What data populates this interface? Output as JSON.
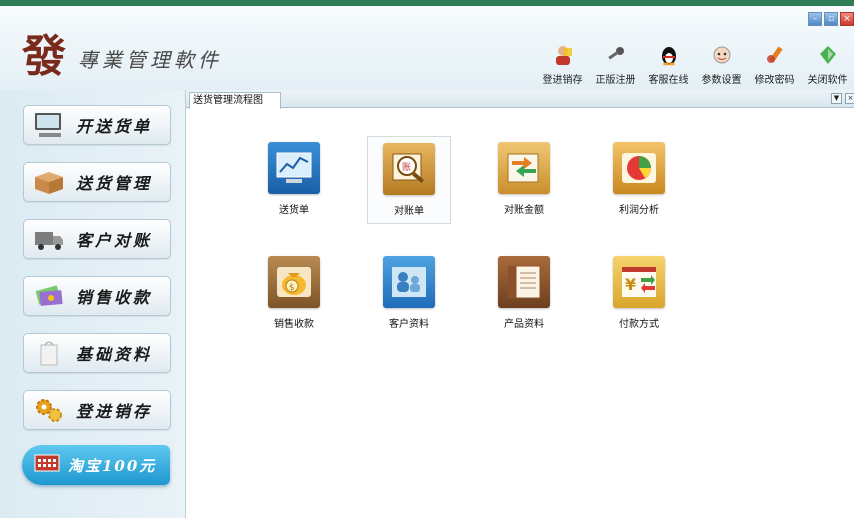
{
  "header": {
    "logo_char": "發",
    "logo_sub": "專業管理軟件",
    "window_controls": [
      "minimize-icon",
      "restore-icon",
      "close-icon"
    ],
    "toolbar": [
      {
        "label": "登进销存",
        "icon": "user-icon"
      },
      {
        "label": "正版注册",
        "icon": "key-icon"
      },
      {
        "label": "客服在线",
        "icon": "penguin-icon"
      },
      {
        "label": "参数设置",
        "icon": "settings-face-icon"
      },
      {
        "label": "修改密码",
        "icon": "pencil-icon"
      },
      {
        "label": "关闭软件",
        "icon": "power-icon"
      }
    ]
  },
  "sidebar": {
    "items": [
      {
        "label": "开送货单",
        "icon": "computer-icon"
      },
      {
        "label": "送货管理",
        "icon": "box-icon"
      },
      {
        "label": "客户对账",
        "icon": "truck-icon"
      },
      {
        "label": "销售收款",
        "icon": "money-icon"
      },
      {
        "label": "基础资料",
        "icon": "bag-icon"
      },
      {
        "label": "登进销存",
        "icon": "gears-icon"
      }
    ],
    "promo_label": "淘宝100元"
  },
  "main": {
    "tab_label": "送货管理流程图",
    "tiles": [
      {
        "label": "送货单",
        "icon": "monitor-chart-icon"
      },
      {
        "label": "对账单",
        "icon": "magnifier-ledger-icon"
      },
      {
        "label": "对账金额",
        "icon": "arrows-chart-icon"
      },
      {
        "label": "利润分析",
        "icon": "pie-chart-icon"
      },
      {
        "label": "销售收款",
        "icon": "money-bag-icon"
      },
      {
        "label": "客户资料",
        "icon": "people-icon"
      },
      {
        "label": "产品资料",
        "icon": "company-book-icon"
      },
      {
        "label": "付款方式",
        "icon": "yuan-exchange-icon"
      }
    ]
  },
  "colors": {
    "top_strip": "#2f7d55",
    "promo": "#1e97cf",
    "sidebar_bg": "#dcebf2"
  }
}
